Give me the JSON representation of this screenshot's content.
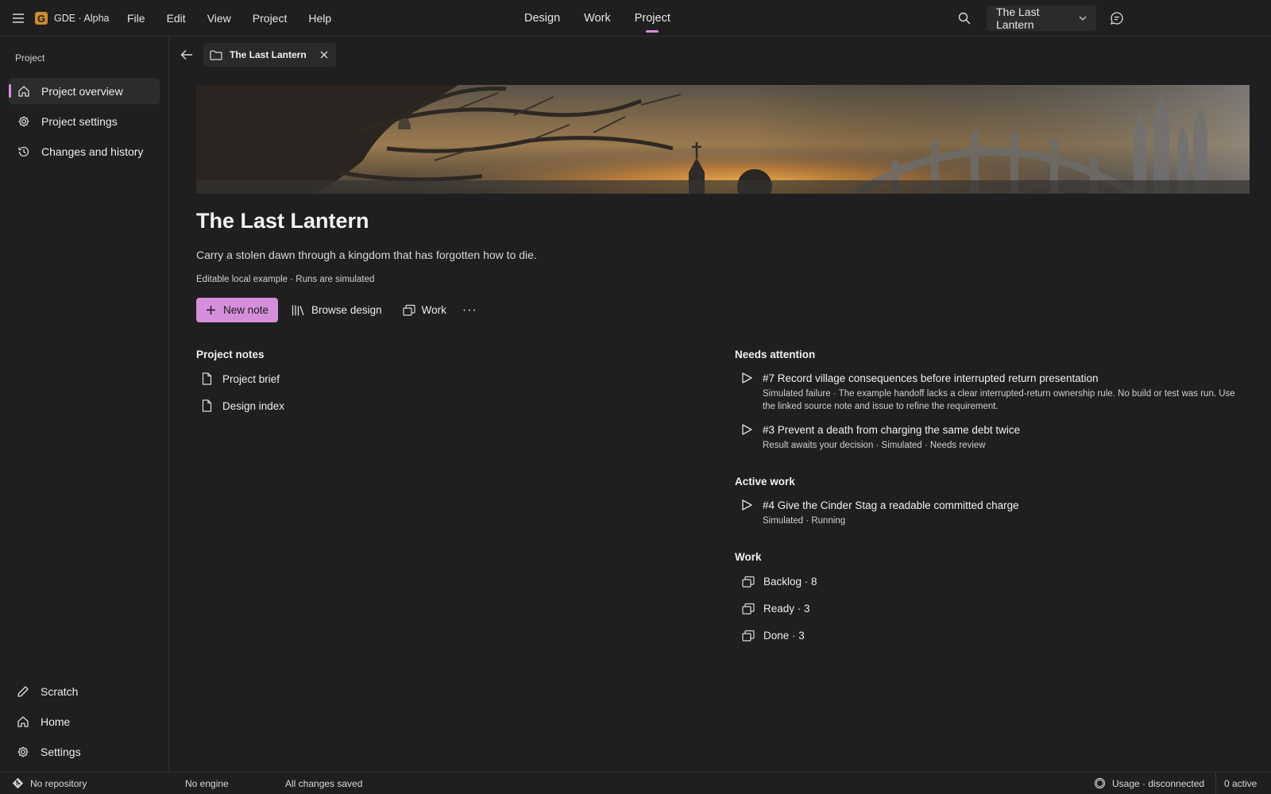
{
  "app": {
    "name": "GDE · Alpha",
    "logo_letter": "G",
    "logo_color": "#d08a2e",
    "accent": "#d98be0"
  },
  "menu": [
    "File",
    "Edit",
    "View",
    "Project",
    "Help"
  ],
  "center_tabs": [
    {
      "label": "Design",
      "active": false
    },
    {
      "label": "Work",
      "active": false
    },
    {
      "label": "Project",
      "active": true
    }
  ],
  "project_switcher": {
    "label": "The Last Lantern"
  },
  "sidebar": {
    "heading": "Project",
    "items": [
      {
        "label": "Project overview",
        "icon": "home-icon",
        "active": true
      },
      {
        "label": "Project settings",
        "icon": "gear-icon",
        "active": false
      },
      {
        "label": "Changes and history",
        "icon": "history-icon",
        "active": false
      }
    ],
    "bottom": [
      {
        "label": "Scratch",
        "icon": "pencil-icon"
      },
      {
        "label": "Home",
        "icon": "home-icon"
      },
      {
        "label": "Settings",
        "icon": "gear-icon"
      }
    ]
  },
  "doc_tab": {
    "label": "The Last Lantern",
    "icon": "folder-icon"
  },
  "project": {
    "title": "The Last Lantern",
    "subtitle": "Carry a stolen dawn through a kingdom that has forgotten how to die.",
    "meta": "Editable local example · Runs are simulated"
  },
  "actions": {
    "new_note": "New note",
    "browse_design": "Browse design",
    "work": "Work",
    "more": "···"
  },
  "project_notes": {
    "heading": "Project notes",
    "items": [
      "Project brief",
      "Design index"
    ]
  },
  "needs_attention": {
    "heading": "Needs attention",
    "items": [
      {
        "title": "#7 Record village consequences before interrupted return presentation",
        "detail": "Simulated failure · The example handoff lacks a clear interrupted-return ownership rule. No build or test was run. Use the linked source note and issue to refine the requirement."
      },
      {
        "title": "#3 Prevent a death from charging the same debt twice",
        "detail": "Result awaits your decision · Simulated · Needs review"
      }
    ]
  },
  "active_work": {
    "heading": "Active work",
    "items": [
      {
        "title": "#4 Give the Cinder Stag a readable committed charge",
        "detail": "Simulated · Running"
      }
    ]
  },
  "work": {
    "heading": "Work",
    "items": [
      "Backlog · 8",
      "Ready · 3",
      "Done · 3"
    ]
  },
  "statusbar": {
    "repository": "No repository",
    "engine": "No engine",
    "save_state": "All changes saved",
    "usage": "Usage · disconnected",
    "active": "0 active"
  }
}
